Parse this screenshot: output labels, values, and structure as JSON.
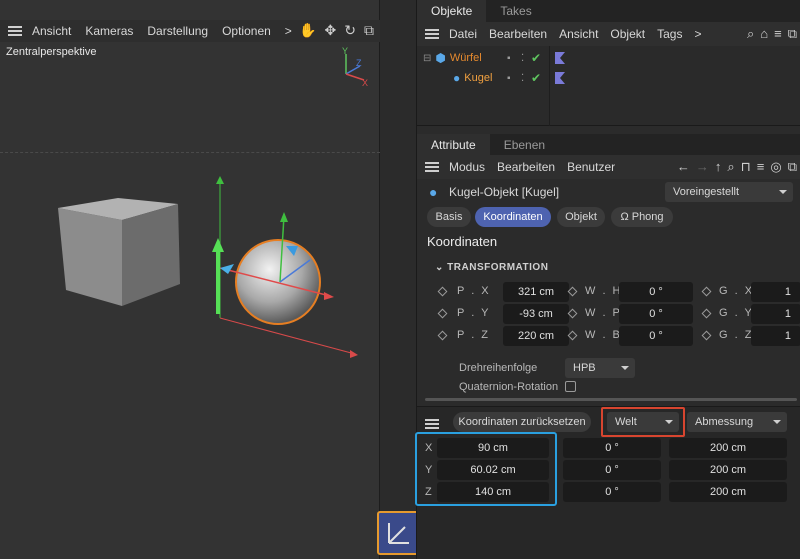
{
  "viewport": {
    "menu": [
      "Ansicht",
      "Kameras",
      "Darstellung",
      "Optionen"
    ],
    "more": ">",
    "label": "Zentralperspektive",
    "axes": {
      "y": "Y",
      "z": "Z",
      "x": "X"
    }
  },
  "objects_panel": {
    "tabs": [
      "Objekte",
      "Takes"
    ],
    "menu": [
      "Datei",
      "Bearbeiten",
      "Ansicht",
      "Objekt",
      "Tags"
    ],
    "more": ">",
    "items": [
      {
        "name": "Würfel"
      },
      {
        "name": "Kugel"
      }
    ]
  },
  "attribute_panel": {
    "tabs": [
      "Attribute",
      "Ebenen"
    ],
    "menu": [
      "Modus",
      "Bearbeiten",
      "Benutzer"
    ],
    "object_title": "Kugel-Objekt [Kugel]",
    "preset": "Voreingestellt",
    "subtabs": [
      "Basis",
      "Koordinaten",
      "Objekt",
      "Ω Phong"
    ],
    "section_title": "Koordinaten",
    "group_title": "TRANSFORMATION",
    "rows": [
      {
        "p_label": "P . X",
        "p_val": "321 cm",
        "w_label": "W . H",
        "w_val": "0 °",
        "g_label": "G . X",
        "g_val": "1"
      },
      {
        "p_label": "P . Y",
        "p_val": "-93 cm",
        "w_label": "W . P",
        "w_val": "0 °",
        "g_label": "G . Y",
        "g_val": "1"
      },
      {
        "p_label": "P . Z",
        "p_val": "220 cm",
        "w_label": "W . B",
        "w_val": "0 °",
        "g_label": "G . Z",
        "g_val": "1"
      }
    ],
    "rotation_order_label": "Drehreihenfolge",
    "rotation_order_value": "HPB",
    "quaternion_label": "Quaternion-Rotation"
  },
  "coord_manager": {
    "reset_label": "Koordinaten zurücksetzen",
    "space_value": "Welt",
    "measure_value": "Abmessung",
    "rows": [
      {
        "axis": "X",
        "pos": "90 cm",
        "rot": "0 °",
        "size": "200 cm"
      },
      {
        "axis": "Y",
        "pos": "60.02 cm",
        "rot": "0 °",
        "size": "200 cm"
      },
      {
        "axis": "Z",
        "pos": "140 cm",
        "rot": "0 °",
        "size": "200 cm"
      }
    ]
  },
  "colors": {
    "accent": "#4e63b0",
    "highlight_red": "#d8452f",
    "highlight_blue": "#2aa0e0",
    "highlight_orange": "#e69a2e"
  }
}
